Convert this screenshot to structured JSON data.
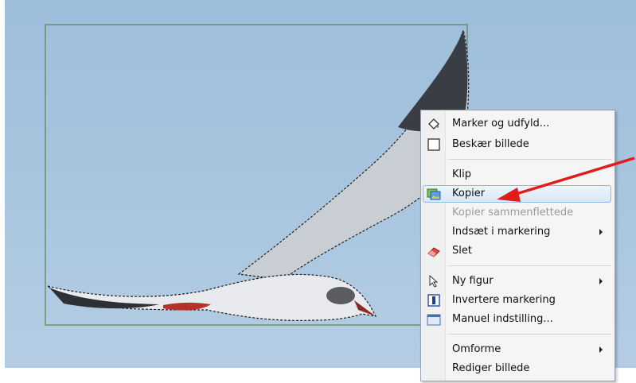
{
  "menu": {
    "items": [
      {
        "label": "Marker og udfyld...",
        "icon": "paint-bucket-icon",
        "enabled": true,
        "submenu": false
      },
      {
        "label": "Beskær billede",
        "icon": "crop-icon",
        "enabled": true,
        "submenu": false
      },
      {
        "label": "Klip",
        "icon": "",
        "enabled": true,
        "submenu": false
      },
      {
        "label": "Kopier",
        "icon": "copy-image-icon",
        "enabled": true,
        "submenu": false,
        "highlighted": true
      },
      {
        "label": "Kopier sammenflettede",
        "icon": "",
        "enabled": false,
        "submenu": false
      },
      {
        "label": "Indsæt i markering",
        "icon": "",
        "enabled": true,
        "submenu": true
      },
      {
        "label": "Slet",
        "icon": "eraser-icon",
        "enabled": true,
        "submenu": false
      },
      {
        "label": "Ny figur",
        "icon": "pointer-icon",
        "enabled": true,
        "submenu": true
      },
      {
        "label": "Invertere markering",
        "icon": "invert-selection-icon",
        "enabled": true,
        "submenu": false
      },
      {
        "label": "Manuel indstilling...",
        "icon": "manual-settings-icon",
        "enabled": true,
        "submenu": false
      },
      {
        "label": "Omforme",
        "icon": "",
        "enabled": true,
        "submenu": true
      },
      {
        "label": "Rediger billede",
        "icon": "",
        "enabled": true,
        "submenu": false
      }
    ]
  },
  "colors": {
    "sky": "#a7c4de",
    "arrow": "#e31b1b",
    "highlight": "#dae8f8",
    "selection": "#6b8f6b"
  }
}
